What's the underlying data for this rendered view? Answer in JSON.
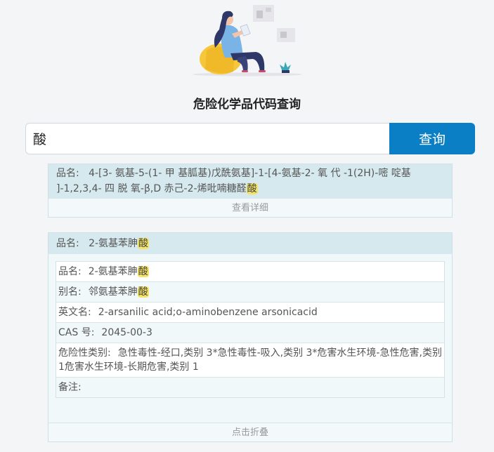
{
  "page": {
    "title": "危险化学品代码查询",
    "illustration": "person-reading-on-beanbag"
  },
  "search": {
    "value": "酸",
    "button_label": "查询"
  },
  "results": [
    {
      "name_label": "品名:",
      "name_before": "4-[3- 氨基-5-(1- 甲 基胍基)戊酰氨基]-1-[4-氨基-2- 氧 代 -1(2H)-嘧 啶基 ]-1,2,3,4- 四 脱 氧-β,D 赤己-2-烯吡喃糖醛",
      "name_highlight": "酸",
      "footer": "查看详细"
    },
    {
      "name_label": "品名:",
      "name_before": "2-氨基苯胂",
      "name_highlight": "酸",
      "details": {
        "name": {
          "label": "品名:",
          "before": "2-氨基苯胂",
          "highlight": "酸"
        },
        "alias": {
          "label": "别名:",
          "before": "邻氨基苯胂",
          "highlight": "酸"
        },
        "english": {
          "label": "英文名:",
          "value": "2-arsanilic acid;o-aminobenzene arsonicacid"
        },
        "cas": {
          "label": "CAS 号:",
          "value": "2045-00-3"
        },
        "hazard": {
          "label": "危险性类别:",
          "value": "急性毒性-经口,类别 3*急性毒性-吸入,类别 3*危害水生环境-急性危害,类别 1危害水生环境-长期危害,类别 1"
        },
        "remark": {
          "label": "备注:",
          "value": ""
        }
      },
      "footer": "点击折叠"
    }
  ],
  "colors": {
    "accent": "#0b7fc5",
    "highlight": "#f5e463",
    "card_header": "#d5e9ef"
  }
}
